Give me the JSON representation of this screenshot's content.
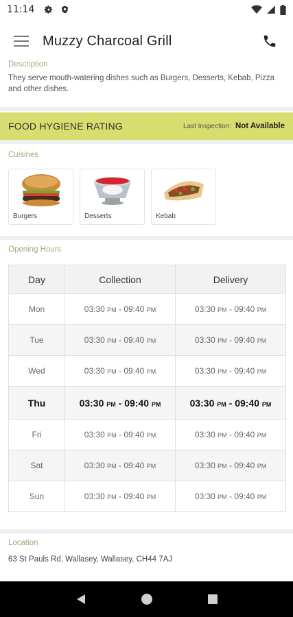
{
  "status_bar": {
    "time": "11:14"
  },
  "app_bar": {
    "title": "Muzzy Charcoal Grill"
  },
  "description": {
    "label": "Description",
    "text": "They serve mouth-watering dishes such as Burgers, Desserts, Kebab, Pizza and other dishes."
  },
  "hygiene": {
    "title": "FOOD HYGIENE RATING",
    "last_inspection_label": "Last Inspection:",
    "last_inspection_value": "Not Available"
  },
  "cuisines": {
    "label": "Cuisines",
    "items": [
      {
        "name": "Burgers"
      },
      {
        "name": "Desserts"
      },
      {
        "name": "Kebab"
      }
    ]
  },
  "opening_hours": {
    "label": "Opening Hours",
    "headers": [
      "Day",
      "Collection",
      "Delivery"
    ],
    "rows": [
      {
        "day": "Mon",
        "collection_open": "03:30",
        "collection_open_ampm": "PM",
        "collection_close": "09:40",
        "collection_close_ampm": "PM",
        "delivery_open": "03:30",
        "delivery_open_ampm": "PM",
        "delivery_close": "09:40",
        "delivery_close_ampm": "PM"
      },
      {
        "day": "Tue",
        "collection_open": "03:30",
        "collection_open_ampm": "PM",
        "collection_close": "09:40",
        "collection_close_ampm": "PM",
        "delivery_open": "03:30",
        "delivery_open_ampm": "PM",
        "delivery_close": "09:40",
        "delivery_close_ampm": "PM"
      },
      {
        "day": "Wed",
        "collection_open": "03:30",
        "collection_open_ampm": "PM",
        "collection_close": "09:40",
        "collection_close_ampm": "PM",
        "delivery_open": "03:30",
        "delivery_open_ampm": "PM",
        "delivery_close": "09:40",
        "delivery_close_ampm": "PM"
      },
      {
        "day": "Thu",
        "collection_open": "03:30",
        "collection_open_ampm": "PM",
        "collection_close": "09:40",
        "collection_close_ampm": "PM",
        "delivery_open": "03:30",
        "delivery_open_ampm": "PM",
        "delivery_close": "09:40",
        "delivery_close_ampm": "PM"
      },
      {
        "day": "Fri",
        "collection_open": "03:30",
        "collection_open_ampm": "PM",
        "collection_close": "09:40",
        "collection_close_ampm": "PM",
        "delivery_open": "03:30",
        "delivery_open_ampm": "PM",
        "delivery_close": "09:40",
        "delivery_close_ampm": "PM"
      },
      {
        "day": "Sat",
        "collection_open": "03:30",
        "collection_open_ampm": "PM",
        "collection_close": "09:40",
        "collection_close_ampm": "PM",
        "delivery_open": "03:30",
        "delivery_open_ampm": "PM",
        "delivery_close": "09:40",
        "delivery_close_ampm": "PM"
      },
      {
        "day": "Sun",
        "collection_open": "03:30",
        "collection_open_ampm": "PM",
        "collection_close": "09:40",
        "collection_close_ampm": "PM",
        "delivery_open": "03:30",
        "delivery_open_ampm": "PM",
        "delivery_close": "09:40",
        "delivery_close_ampm": "PM"
      }
    ]
  },
  "location": {
    "label": "Location",
    "address": "63 St Pauls Rd, Wallasey, Wallasey, CH44 7AJ"
  },
  "colors": {
    "hygiene_bar": "#d7dd6f",
    "section_label": "#a7a77a",
    "nav_bar": "#000000"
  }
}
